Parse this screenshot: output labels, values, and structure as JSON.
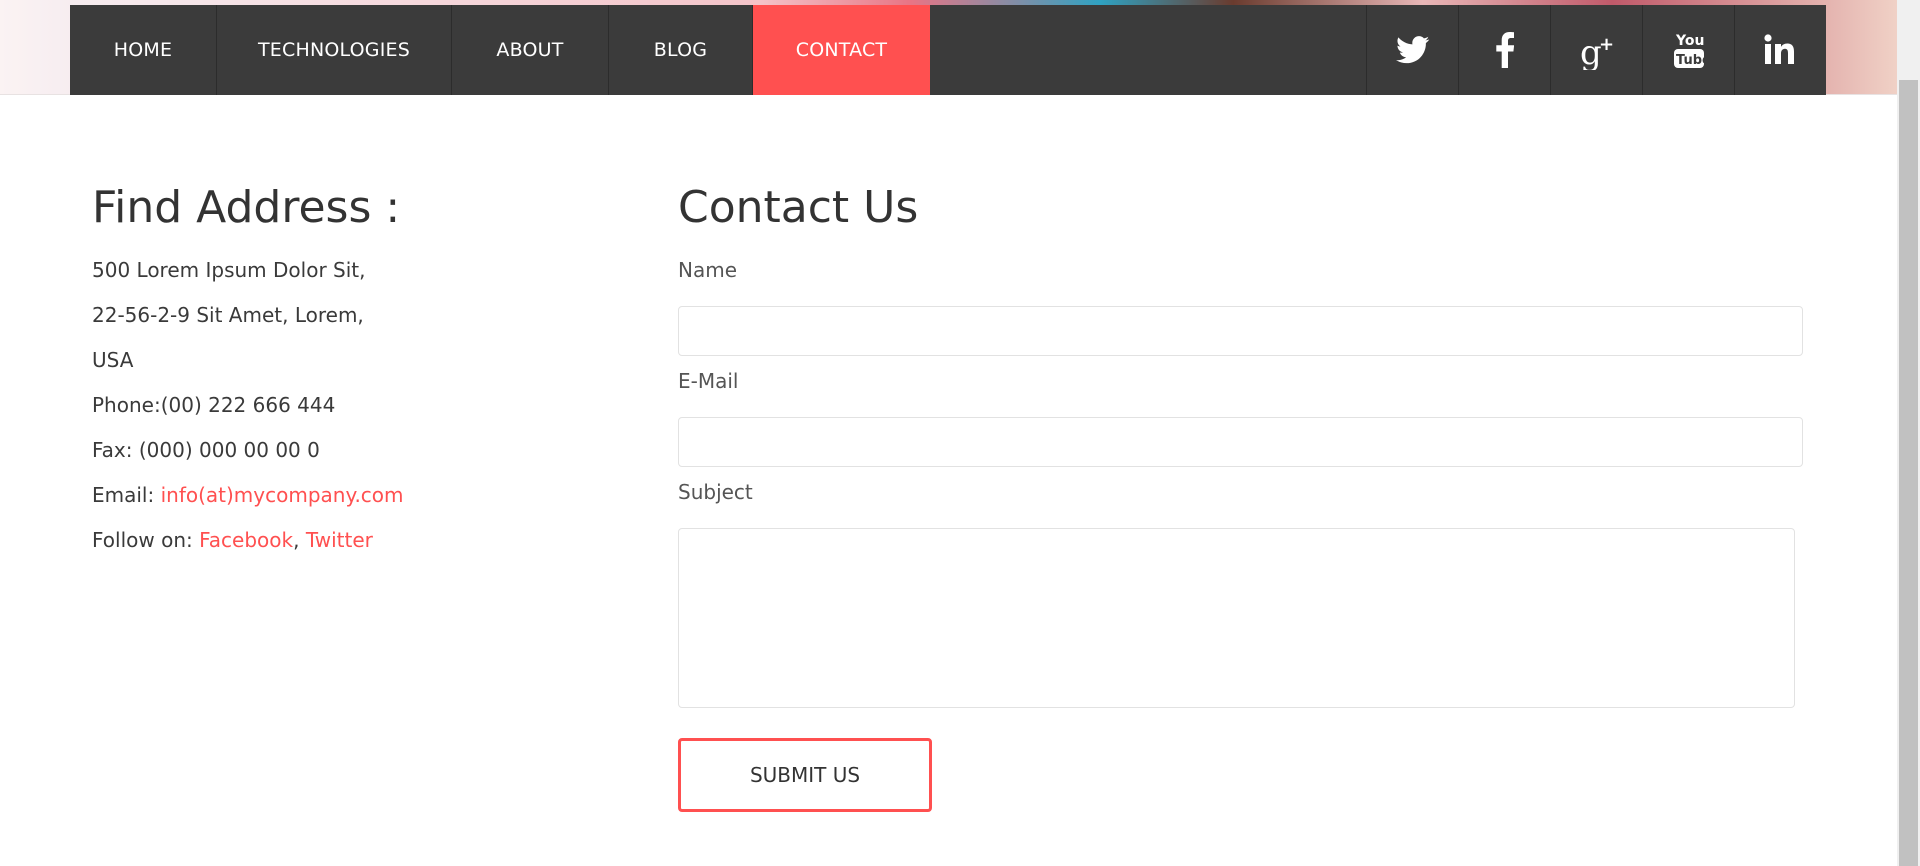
{
  "nav": {
    "items": [
      {
        "label": "HOME",
        "active": false
      },
      {
        "label": "TECHNOLOGIES",
        "active": false
      },
      {
        "label": "ABOUT",
        "active": false
      },
      {
        "label": "BLOG",
        "active": false
      },
      {
        "label": "CONTACT",
        "active": true
      }
    ],
    "social": [
      "twitter-icon",
      "facebook-icon",
      "google-plus-icon",
      "youtube-icon",
      "linkedin-icon"
    ]
  },
  "address": {
    "heading": "Find Address :",
    "line1": "500 Lorem Ipsum Dolor Sit,",
    "line2": "22-56-2-9 Sit Amet, Lorem,",
    "line3": "USA",
    "phone": "Phone:(00) 222 666 444",
    "fax": "Fax: (000) 000 00 00 0",
    "email_label": "Email: ",
    "email_value": "info(at)mycompany.com",
    "follow_label": "Follow on: ",
    "follow_facebook": "Facebook",
    "follow_separator": ", ",
    "follow_twitter": "Twitter"
  },
  "contact": {
    "heading": "Contact Us",
    "name_label": "Name",
    "name_value": "",
    "email_label": "E-Mail",
    "email_value": "",
    "subject_label": "Subject",
    "subject_value": "",
    "submit_label": "SUBMIT US"
  },
  "colors": {
    "accent": "#ff5050",
    "nav_bg": "#3b3b3b",
    "text": "#333333"
  }
}
